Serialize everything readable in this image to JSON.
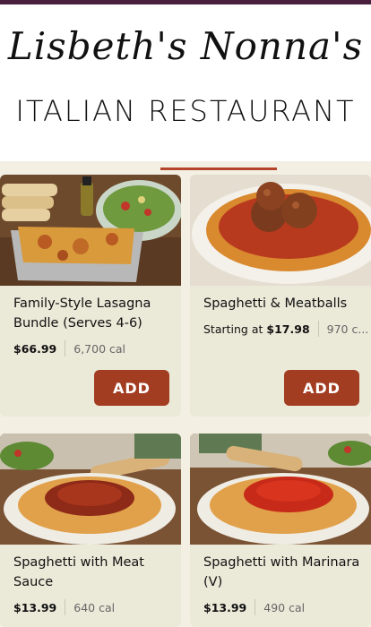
{
  "header": {
    "script_title": "Lisbeth's Nonna's",
    "subtitle": "ITALIAN RESTAURANT"
  },
  "menu_items": [
    {
      "name": "Family-Style Lasagna Bundle (Serves 4-6)",
      "price": "$66.99",
      "calories": "6,700 cal",
      "button": "ADD"
    },
    {
      "name": "Spaghetti & Meatballs",
      "price_prefix": "Starting at",
      "price": "$17.98",
      "calories": "970 c...",
      "button": "ADD"
    },
    {
      "name": "Spaghetti with Meat Sauce",
      "price": "$13.99",
      "calories": "640 cal"
    },
    {
      "name": "Spaghetti with Marinara (V)",
      "price": "$13.99",
      "calories": "490 cal"
    }
  ],
  "colors": {
    "accent": "#a33d22",
    "card_bg": "#ebe9d8",
    "page_bg": "#f3f0e3",
    "top_bar": "#4a1f3d"
  }
}
